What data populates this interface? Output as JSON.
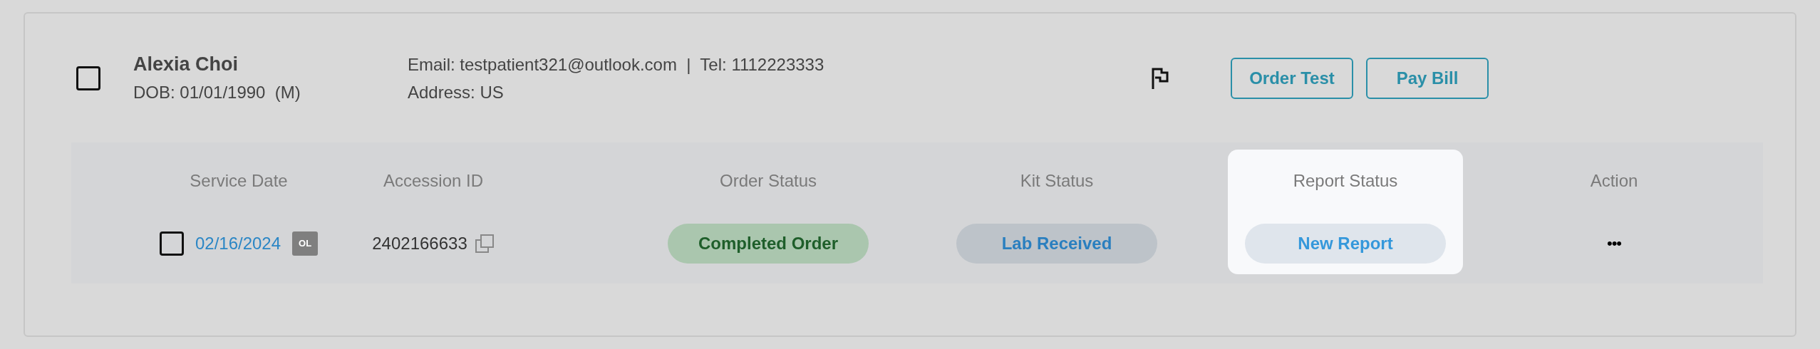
{
  "patient": {
    "checked": false,
    "name": "Alexia Choi",
    "dob": "DOB: 01/01/1990  (M)",
    "contact": "Email: testpatient321@outlook.com  |  Tel: 1112223333",
    "address": "Address: US"
  },
  "buttons": [
    "Order Test",
    "Pay Bill"
  ],
  "table": {
    "columns": [
      {
        "label": "Service Date",
        "highlighted": false
      },
      {
        "label": "Accession ID",
        "highlighted": false
      },
      {
        "label": "Order Status",
        "highlighted": false
      },
      {
        "label": "Kit Status",
        "highlighted": false
      },
      {
        "label": "Report Status",
        "highlighted": true
      },
      {
        "label": "Action",
        "highlighted": false
      }
    ],
    "rows": [
      {
        "selected": false,
        "service_date": "02/16/2024",
        "source_badge": "OL",
        "accession_id": "2402166633",
        "order_status": {
          "label": "Completed Order",
          "kind": "completed"
        },
        "kit_status": {
          "label": "Lab Received",
          "kind": "received"
        },
        "report_status": {
          "label": "New Report",
          "kind": "new"
        },
        "action": "•••"
      }
    ]
  }
}
